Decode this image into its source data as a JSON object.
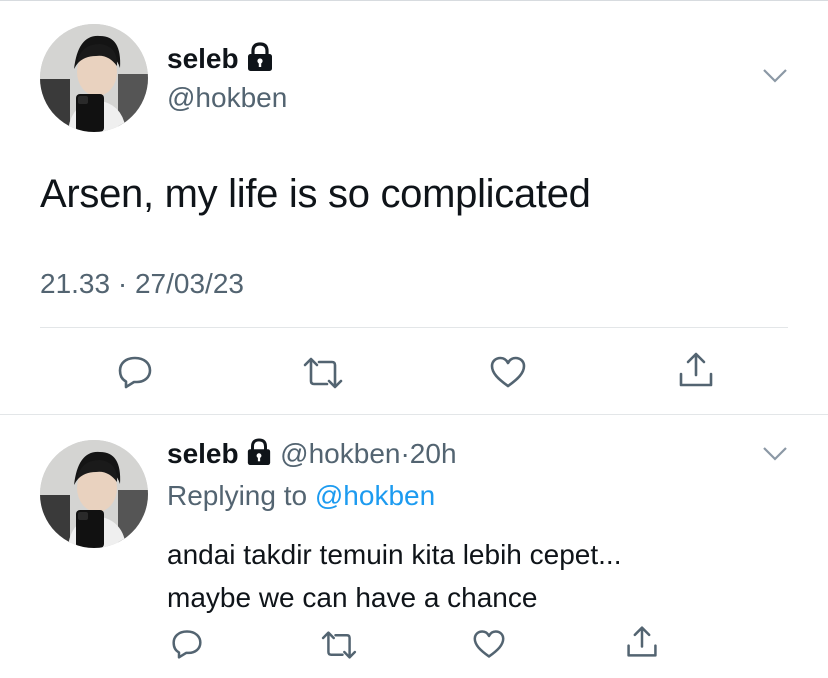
{
  "tweet": {
    "display_name": "seleb",
    "handle": "@hokben",
    "text": "Arsen, my life is so complicated",
    "time": "21.33",
    "date": "27/03/23",
    "separator": "·"
  },
  "reply": {
    "display_name": "seleb",
    "handle": "@hokben",
    "separator": "·",
    "age": "20h",
    "replying_prefix": "Replying to",
    "replying_to": "@hokben",
    "lines": [
      "andai takdir temuin kita lebih cepet...",
      "maybe we can have a chance"
    ]
  },
  "icons": {
    "account": "lock-icon",
    "menu": "chevron-down-icon",
    "actions": [
      "reply-icon",
      "retweet-icon",
      "like-icon",
      "share-icon"
    ]
  },
  "colors": {
    "text": "#0f1419",
    "secondary": "#536471",
    "link": "#1d9bf0",
    "divider": "#e3e6e8"
  }
}
